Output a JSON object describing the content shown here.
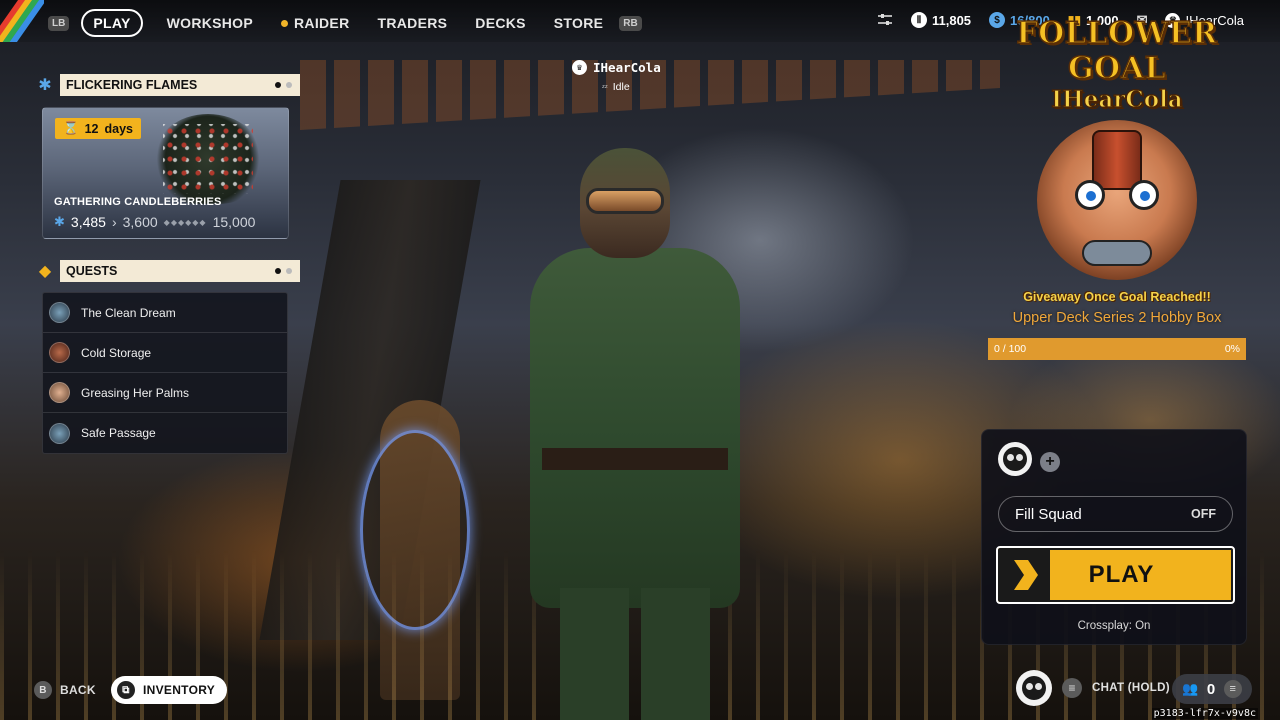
{
  "nav": {
    "lb": "LB",
    "rb": "RB",
    "items": [
      {
        "label": "PLAY",
        "active": true
      },
      {
        "label": "WORKSHOP"
      },
      {
        "label": "RAIDER"
      },
      {
        "label": "TRADERS"
      },
      {
        "label": "DECKS"
      },
      {
        "label": "STORE"
      }
    ]
  },
  "currencies": {
    "coins": "11,805",
    "stash": "16/800",
    "tokens": "1,000",
    "username": "IHearCola"
  },
  "event": {
    "header": "FLICKERING FLAMES",
    "days_left": "12",
    "days_unit": "days",
    "title": "GATHERING CANDLEBERRIES",
    "current": "3,485",
    "next": "3,600",
    "max": "15,000"
  },
  "quests": {
    "header": "QUESTS",
    "items": [
      {
        "label": "The Clean Dream"
      },
      {
        "label": "Cold Storage"
      },
      {
        "label": "Greasing Her Palms"
      },
      {
        "label": "Safe Passage"
      }
    ]
  },
  "player": {
    "name": "IHearCola",
    "status": "Idle"
  },
  "goal": {
    "title": "FOLLOWER GOAL",
    "name": "IHearCola",
    "giveaway": "Giveaway Once Goal Reached!!",
    "prize": "Upper Deck Series 2 Hobby Box",
    "progress_text": "0 / 100",
    "percent_text": "0%",
    "progress": 0
  },
  "squad": {
    "fill_label": "Fill Squad",
    "fill_value": "OFF",
    "play_label": "PLAY",
    "crossplay": "Crossplay: On"
  },
  "bottom": {
    "back_key": "B",
    "back_label": "BACK",
    "inventory_label": "INVENTORY",
    "chat_label": "CHAT (HOLD)",
    "friends_count": "0",
    "build_id": "p3183-lfr7x-v9v8c"
  },
  "colors": {
    "accent": "#f2b31d",
    "event_header_bg": "#f3ead6",
    "goal_bar": "#e09a2e"
  }
}
